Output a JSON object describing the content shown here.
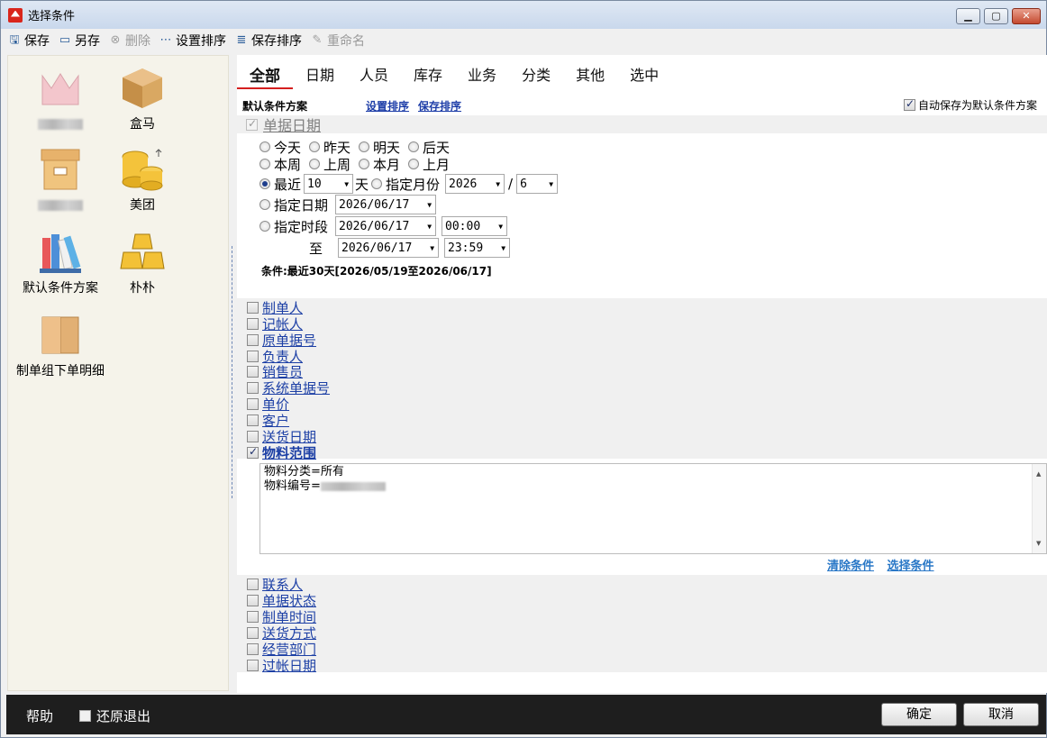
{
  "window": {
    "title": "选择条件"
  },
  "toolbar": {
    "save": "保存",
    "save_as": "另存",
    "delete": "删除",
    "set_sort": "设置排序",
    "save_sort": "保存排序",
    "rename": "重命名"
  },
  "schemes": {
    "items": [
      {
        "label": "下件单",
        "blurred": true
      },
      {
        "label": "盒马"
      },
      {
        "label": "",
        "blurred": true
      },
      {
        "label": "美团"
      },
      {
        "label": "默认条件方案"
      },
      {
        "label": "朴朴"
      },
      {
        "label": "制单组下单明细"
      }
    ]
  },
  "tabs": [
    "全部",
    "日期",
    "人员",
    "库存",
    "业务",
    "分类",
    "其他",
    "选中"
  ],
  "header": {
    "default_scheme": "默认条件方案",
    "set_sort_link": "设置排序",
    "save_sort_link": "保存排序",
    "auto_save": "自动保存为默认条件方案"
  },
  "date": {
    "title": "单据日期",
    "row1": [
      "今天",
      "昨天",
      "明天",
      "后天"
    ],
    "row2": [
      "本周",
      "上周",
      "本月",
      "上月"
    ],
    "recent_label": "最近",
    "recent_value": "10",
    "day_unit": "天",
    "month_label": "指定月份",
    "year_value": "2026",
    "slash": "/",
    "month_value": "6",
    "specific_date_label": "指定日期",
    "specific_date_value": "2026/06/17",
    "period_label": "指定时段",
    "period_from_date": "2026/06/17",
    "period_from_time": "00:00",
    "to_label": "至",
    "period_to_date": "2026/06/17",
    "period_to_time": "23:59",
    "summary": "条件:最近30天[2026/05/19至2026/06/17]"
  },
  "fields_a": [
    "制单人",
    "记帐人",
    "原单据号",
    "负责人",
    "销售员",
    "系统单据号",
    "单价",
    "客户",
    "送货日期"
  ],
  "material": {
    "label": "物料范围",
    "line1": "物料分类=所有",
    "line2_prefix": "物料编号="
  },
  "material_links": {
    "clear": "清除条件",
    "select": "选择条件"
  },
  "fields_b": [
    "联系人",
    "单据状态",
    "制单时间",
    "送货方式",
    "经营部门",
    "过帐日期"
  ],
  "bottom": {
    "help": "帮助",
    "restore_exit": "还原退出",
    "ok": "确定",
    "cancel": "取消"
  }
}
